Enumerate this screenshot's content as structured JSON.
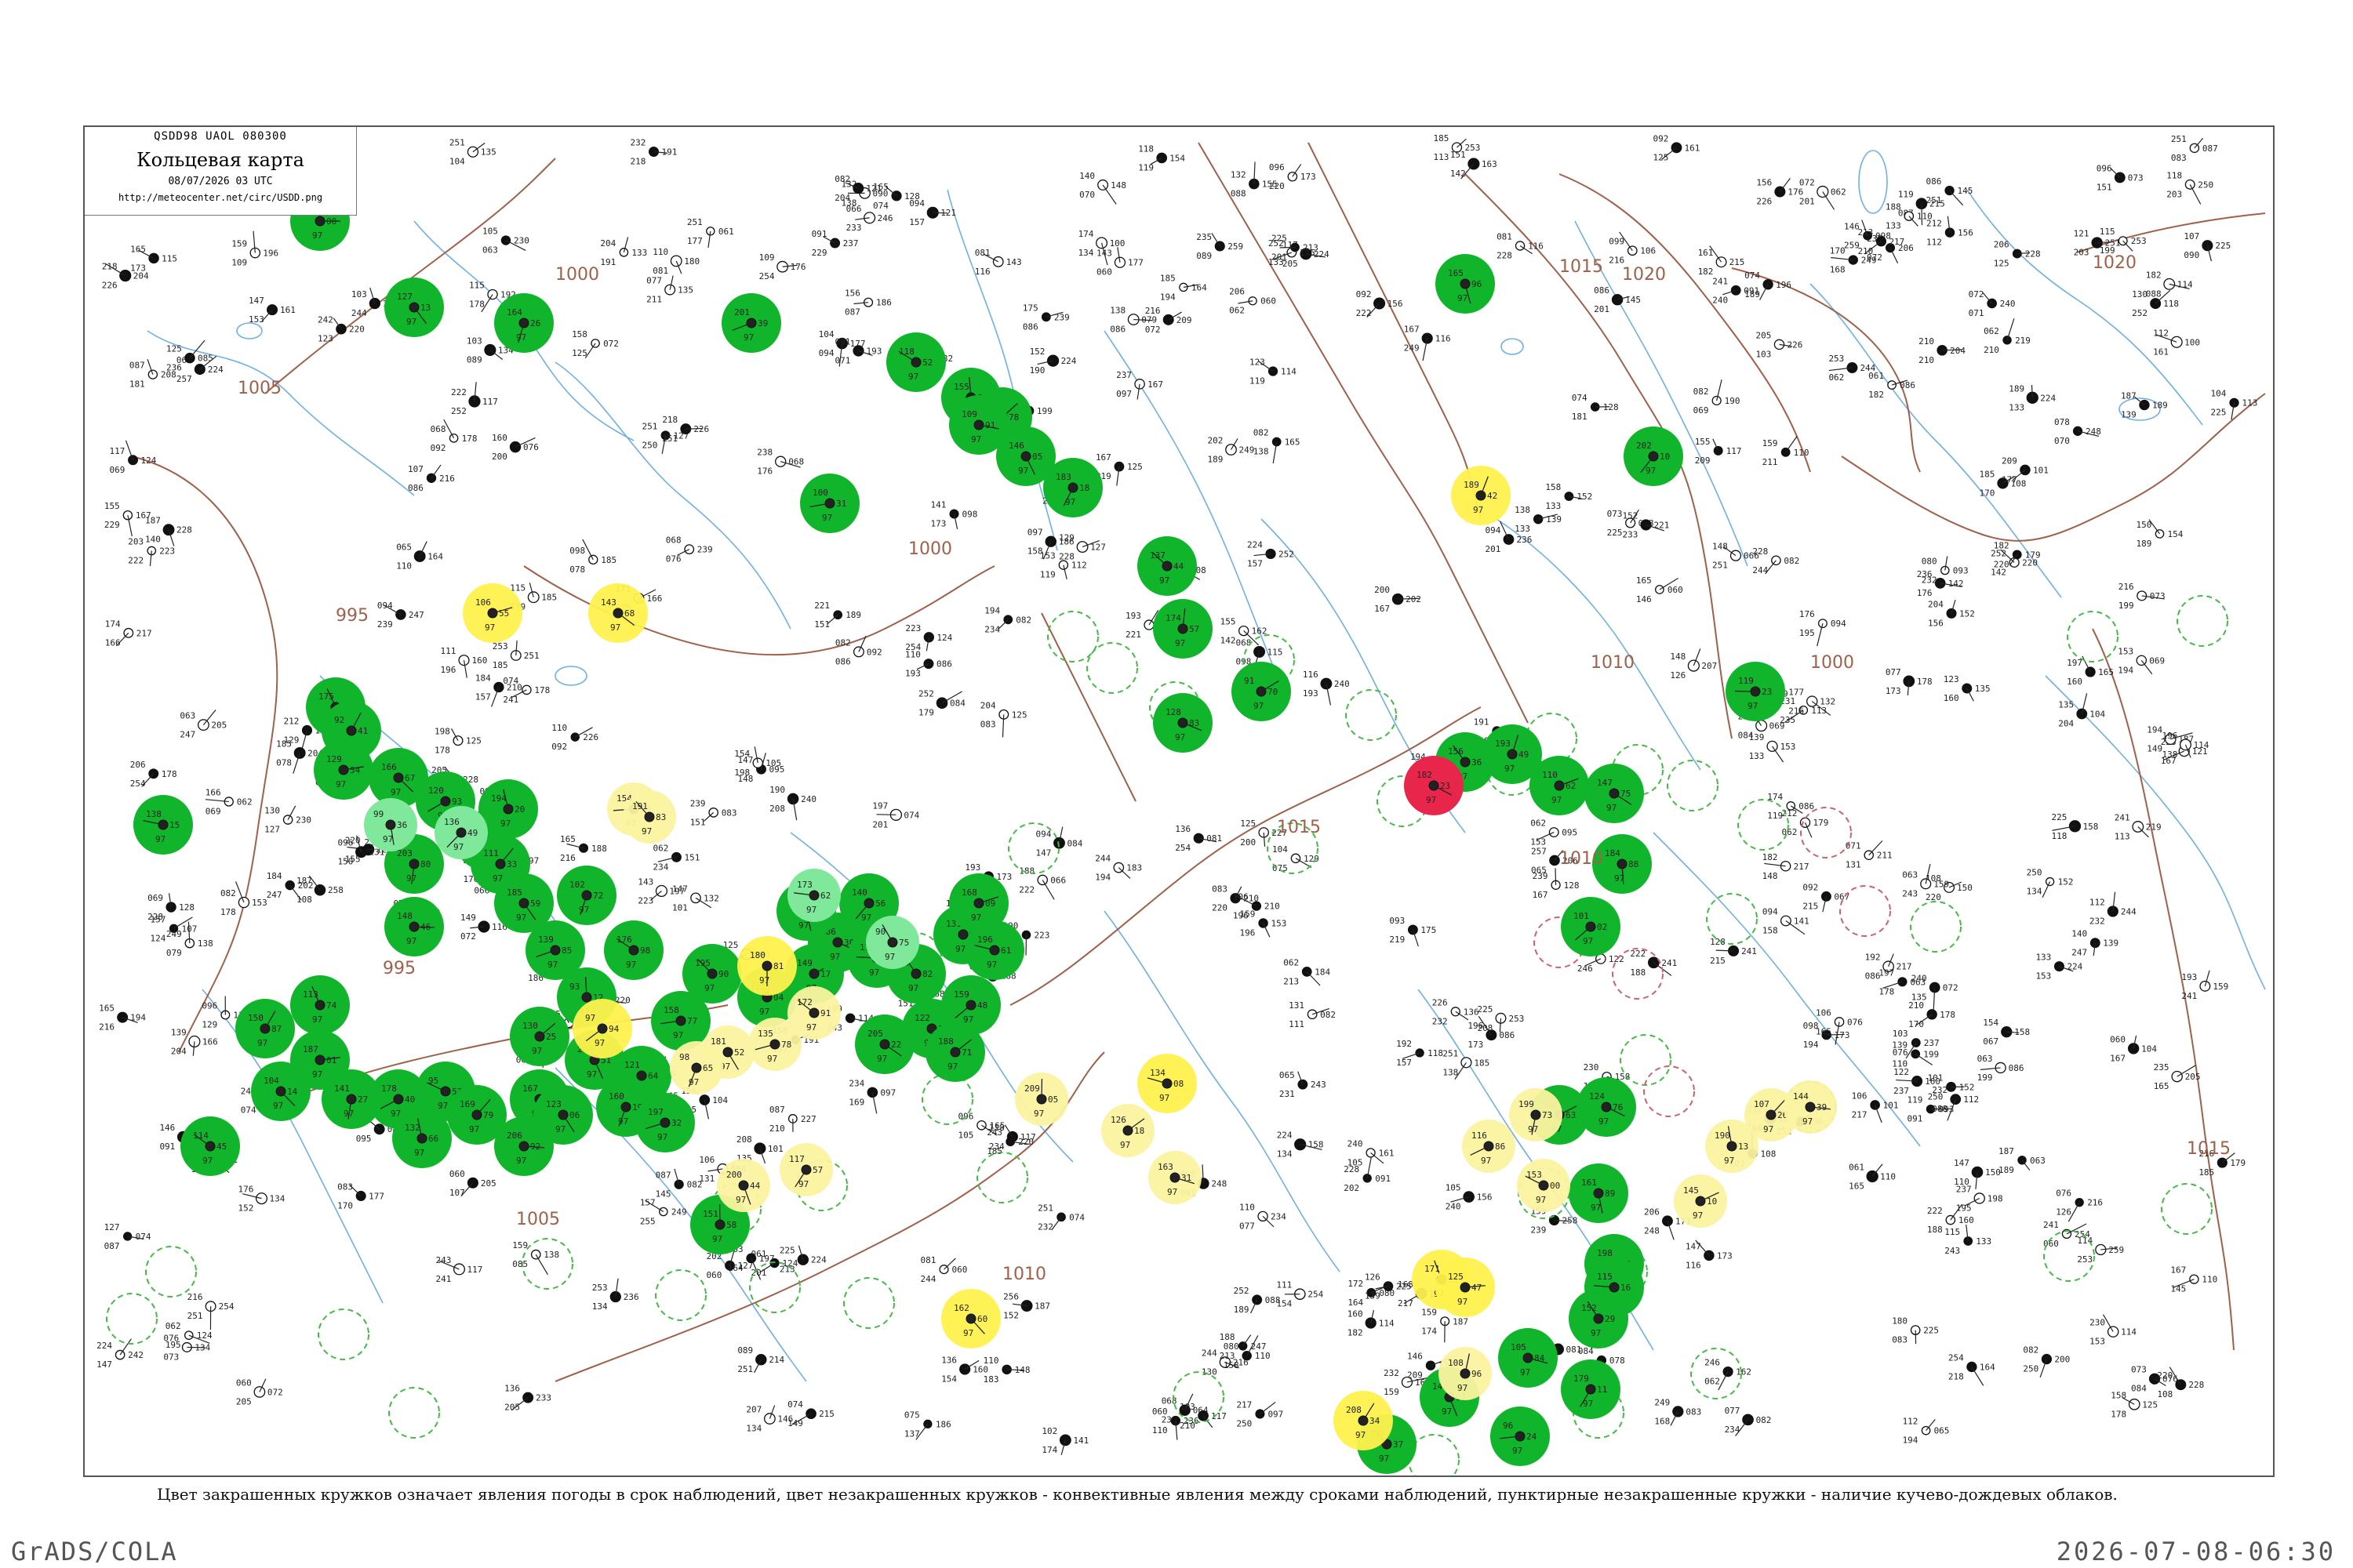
{
  "header": {
    "code_line": "QSDD98  UAOL  080300",
    "title": "Кольцевая карта",
    "datetime": "08/07/2026 03 UTC",
    "url": "http://meteocenter.net/circ/USDD.png"
  },
  "caption": "Цвет закрашенных кружков означает явления погоды в срок наблюдений, цвет незакрашенных кружков - конвективные явления между сроками наблюдений, пунктирные незакрашенные кружки - наличие кучево-дождевых облаков.",
  "footer": {
    "left": "GrADS/COLA",
    "right": "2026-07-08-06:30"
  },
  "colors": {
    "green": "#11b52b",
    "yellow": "#fff14d",
    "light_yellow": "#fbf3a0",
    "light_green": "#7fe89a",
    "red": "#e8264c",
    "isobar": "#a0604a",
    "river": "#6fb0e6",
    "dashed_green": "#44bb44",
    "dashed_red": "#d06070"
  },
  "isobar_labels": [
    "1000",
    "1005",
    "1015",
    "1020",
    "1020",
    "1000",
    "1010",
    "995",
    "995",
    "1005",
    "1010",
    "1010",
    "1015",
    "1015",
    "1000"
  ],
  "stations": [
    {
      "t": "green",
      "n": "113"
    },
    {
      "t": "green",
      "n": "112"
    },
    {
      "t": "green",
      "n": "105"
    },
    {
      "t": "green",
      "n": "119"
    },
    {
      "t": "green",
      "n": "109"
    },
    {
      "t": "green",
      "n": "118"
    },
    {
      "t": "green",
      "n": "103"
    },
    {
      "t": "green",
      "n": "126"
    },
    {
      "t": "green",
      "n": "133"
    },
    {
      "t": "green",
      "n": "95"
    },
    {
      "t": "green",
      "n": "115"
    },
    {
      "t": "green",
      "n": "123"
    },
    {
      "t": "green",
      "n": "128"
    },
    {
      "t": "green",
      "n": "124"
    },
    {
      "t": "green",
      "n": "131"
    },
    {
      "t": "green",
      "n": "140"
    },
    {
      "t": "green",
      "n": "147"
    },
    {
      "t": "green",
      "n": "151"
    },
    {
      "t": "green",
      "n": "160"
    },
    {
      "t": "green",
      "n": "163"
    },
    {
      "t": "yellow",
      "n": "144"
    },
    {
      "t": "yellow",
      "n": "111"
    },
    {
      "t": "yellow",
      "n": "97"
    },
    {
      "t": "yellow",
      "n": "194"
    },
    {
      "t": "yellow",
      "n": "157"
    },
    {
      "t": "yellow",
      "n": "147"
    },
    {
      "t": "yellow",
      "n": "187"
    },
    {
      "t": "yellow",
      "n": "159"
    },
    {
      "t": "red",
      "n": "186"
    },
    {
      "t": "light_green",
      "n": "129"
    },
    {
      "t": "light_yellow",
      "n": "168"
    },
    {
      "t": "light_yellow",
      "n": "260"
    }
  ]
}
